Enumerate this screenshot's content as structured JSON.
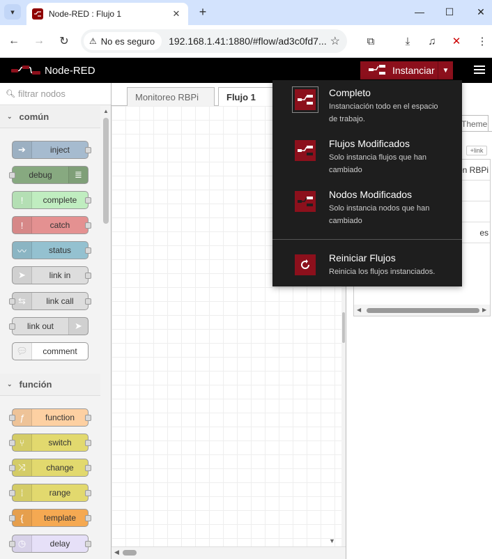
{
  "browser": {
    "tab_title": "Node-RED : Flujo 1",
    "security_label": "No es seguro",
    "url": "192.168.1.41:1880/#flow/ad3c0fd7..."
  },
  "header": {
    "app_title": "Node-RED",
    "deploy_label": "Instanciar"
  },
  "palette": {
    "search_placeholder": "filtrar nodos",
    "categories": [
      {
        "label": "común",
        "nodes": [
          {
            "label": "inject",
            "color": "#a6bbcf",
            "icon": "arrow-icon"
          },
          {
            "label": "debug",
            "color": "#87a980",
            "icon": "list-icon"
          },
          {
            "label": "complete",
            "color": "#c0edc0",
            "icon": "exclamation-icon"
          },
          {
            "label": "catch",
            "color": "#e49191",
            "icon": "exclamation-icon"
          },
          {
            "label": "status",
            "color": "#94c1d0",
            "icon": "pulse-icon"
          },
          {
            "label": "link in",
            "color": "#dddddd",
            "icon": "link-in-icon"
          },
          {
            "label": "link call",
            "color": "#dddddd",
            "icon": "link-call-icon"
          },
          {
            "label": "link out",
            "color": "#dddddd",
            "icon": "link-out-icon"
          },
          {
            "label": "comment",
            "color": "#ffffff",
            "icon": "speech-bubble-icon"
          }
        ]
      },
      {
        "label": "función",
        "nodes": [
          {
            "label": "function",
            "color": "#fdd0a2",
            "icon": "function-icon"
          },
          {
            "label": "switch",
            "color": "#e2d96e",
            "icon": "switch-icon"
          },
          {
            "label": "change",
            "color": "#e2d96e",
            "icon": "shuffle-icon"
          },
          {
            "label": "range",
            "color": "#e2d96e",
            "icon": "range-icon"
          },
          {
            "label": "template",
            "color": "#f5a952",
            "icon": "brace-icon"
          },
          {
            "label": "delay",
            "color": "#e6e0f8",
            "icon": "timer-icon"
          }
        ]
      }
    ]
  },
  "workspace": {
    "tabs": [
      {
        "label": "Monitoreo RBPi",
        "active": false
      },
      {
        "label": "Flujo 1",
        "active": true
      }
    ]
  },
  "sidebar": {
    "tab_fragment": "Theme",
    "link_label": "link",
    "rows": [
      "zon RBPi",
      "",
      "",
      "es"
    ]
  },
  "deploy_menu": {
    "items": [
      {
        "title": "Completo",
        "description": "Instanciación todo en el espacio de trabajo.",
        "selected": true
      },
      {
        "title": "Flujos Modificados",
        "description": "Solo instancia flujos que han cambiado",
        "selected": false
      },
      {
        "title": "Nodos Modificados",
        "description": "Solo instancia nodos que han cambiado",
        "selected": false
      },
      {
        "title": "Reiniciar Flujos",
        "description": "Reinicia los flujos instanciados.",
        "selected": false
      }
    ]
  },
  "colors": {
    "deploy_red": "#8c101c",
    "header_black": "#000000",
    "menu_bg": "#1e1e1e"
  }
}
